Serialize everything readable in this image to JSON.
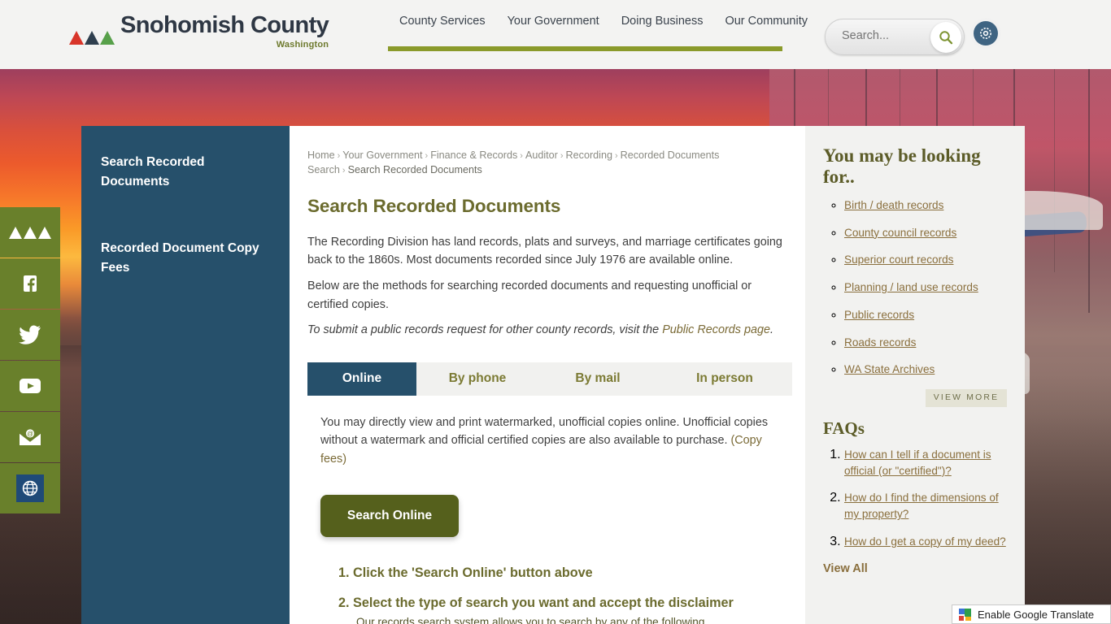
{
  "header": {
    "logo": {
      "main": "Snohomish County",
      "sub": "Washington",
      "peak_colors": [
        "#d8352a",
        "#2e3e4e",
        "#57a04a"
      ]
    },
    "nav": [
      {
        "label": "County Services"
      },
      {
        "label": "Your Government"
      },
      {
        "label": "Doing Business"
      },
      {
        "label": "Our Community"
      }
    ],
    "accent_color": "#8a9a2b",
    "search": {
      "placeholder": "Search...",
      "value": "",
      "icon": "search-icon"
    },
    "settings": {
      "icon": "gear-icon"
    }
  },
  "social_rail": [
    {
      "name": "county-logo",
      "icon": "mountain-peaks-icon"
    },
    {
      "name": "facebook",
      "icon": "facebook-icon"
    },
    {
      "name": "twitter",
      "icon": "twitter-icon"
    },
    {
      "name": "youtube",
      "icon": "youtube-icon"
    },
    {
      "name": "email",
      "icon": "envelope-icon"
    },
    {
      "name": "translate",
      "icon": "globe-icon"
    }
  ],
  "left_nav": {
    "items": [
      {
        "label": "Search Recorded Documents"
      },
      {
        "label": "Recorded Document Copy Fees"
      }
    ]
  },
  "breadcrumb": {
    "items": [
      "Home",
      "Your Government",
      "Finance & Records",
      "Auditor",
      "Recording",
      "Recorded Documents Search"
    ],
    "current": "Search Recorded Documents",
    "separator": "›"
  },
  "main": {
    "title": "Search Recorded Documents",
    "paragraphs": [
      {
        "text": "The Recording Division has land records, plats and surveys, and marriage certificates going back to the 1860s. Most documents recorded since July 1976 are available online.",
        "italic": false
      },
      {
        "text": "Below are the methods for searching recorded documents and requesting unofficial or certified copies.",
        "italic": false
      }
    ],
    "italic_line": {
      "before": "To submit a public records request for other county records, visit the ",
      "link": "Public Records page",
      "after": "."
    },
    "tabs": [
      {
        "label": "Online",
        "active": true
      },
      {
        "label": "By phone",
        "active": false
      },
      {
        "label": "By mail",
        "active": false
      },
      {
        "label": "In person",
        "active": false
      }
    ],
    "tab_panel": {
      "text_before": "You may directly view and print watermarked, unofficial copies online. Unofficial copies without a watermark and official certified copies are also available to purchase. ",
      "link": "(Copy fees)",
      "button_label": "Search Online",
      "steps": [
        {
          "number": "1.",
          "text": "Click the 'Search Online' button above",
          "sub": ""
        },
        {
          "number": "2.",
          "text": "Select the type of search you want and accept the disclaimer",
          "sub": "Our records search system allows you to search by any of the following"
        }
      ]
    }
  },
  "right": {
    "looking_for_title": "You may be looking for..",
    "looking_for_links": [
      "Birth / death records",
      "County council records",
      "Superior court records",
      "Planning / land use records",
      "Public records",
      "Roads records",
      "WA State Archives"
    ],
    "view_more_label": "VIEW MORE",
    "faqs_title": "FAQs",
    "faqs": [
      "How can I tell if a document is official (or \"certified\")?",
      "How do I find the dimensions of my property?",
      "How do I get a copy of my deed?"
    ],
    "view_all_label": "View All"
  },
  "google_translate": {
    "label": "Enable Google Translate",
    "icon": "google-translate-icon"
  }
}
